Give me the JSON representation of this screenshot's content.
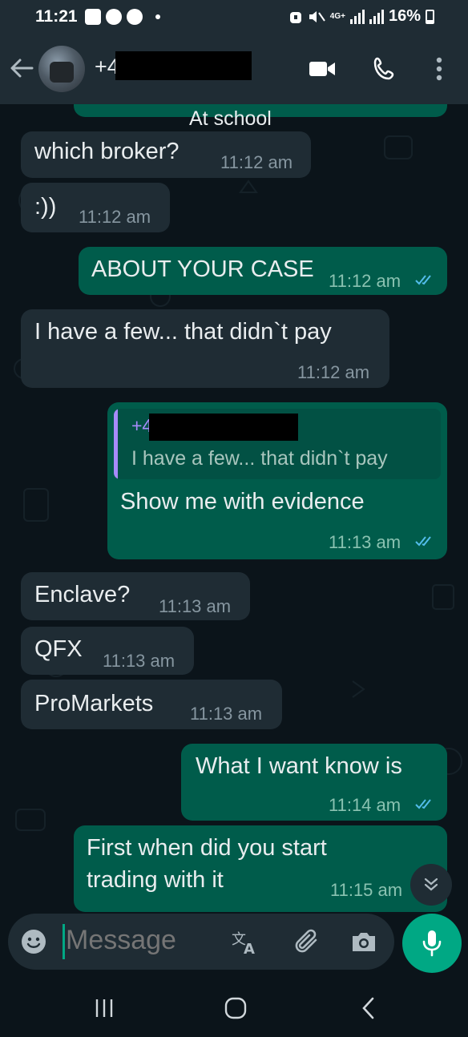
{
  "status_bar": {
    "time": "11:21",
    "network": "4G+",
    "battery": "16%",
    "battery_level": 0.16
  },
  "header": {
    "contact_name": "+4          2",
    "video_icon": "video-call-icon",
    "call_icon": "phone-icon",
    "menu_icon": "more-vert-icon"
  },
  "chat": {
    "top_partial_caption": "At school",
    "messages": [
      {
        "direction": "in",
        "text": "which broker?",
        "time": "11:12 am"
      },
      {
        "direction": "in",
        "text": ":))",
        "time": "11:12 am"
      },
      {
        "direction": "out",
        "text": "ABOUT YOUR CASE",
        "time": "11:12 am",
        "status": "read"
      },
      {
        "direction": "in",
        "text": "I have a few... that didn`t pay",
        "time": "11:12 am"
      },
      {
        "direction": "out",
        "reply_to": {
          "author": "+4          2",
          "text": "I have a few... that didn`t pay"
        },
        "text": "Show me with evidence",
        "time": "11:13 am",
        "status": "read"
      },
      {
        "direction": "in",
        "text": "Enclave?",
        "time": "11:13 am"
      },
      {
        "direction": "in",
        "text": "QFX",
        "time": "11:13 am"
      },
      {
        "direction": "in",
        "text": "ProMarkets",
        "time": "11:13 am"
      },
      {
        "direction": "out",
        "text": "What I want know is",
        "time": "11:14 am",
        "status": "read"
      },
      {
        "direction": "out",
        "text_lines": [
          "First when did you start",
          "trading with it"
        ],
        "time": "11:15 am"
      }
    ]
  },
  "composer": {
    "placeholder": "Message",
    "icons": [
      "emoji-icon",
      "translate-icon",
      "attach-icon",
      "camera-icon",
      "mic-icon"
    ]
  },
  "navbar": {
    "icons": [
      "recents-icon",
      "home-icon",
      "back-icon"
    ]
  },
  "colors": {
    "background": "#0b141a",
    "bar": "#1f2c34",
    "incoming": "#1f2c34",
    "outgoing": "#005c4b",
    "accent": "#00a884",
    "read_ticks": "#53bdeb",
    "reply_author": "#a78bfa"
  }
}
